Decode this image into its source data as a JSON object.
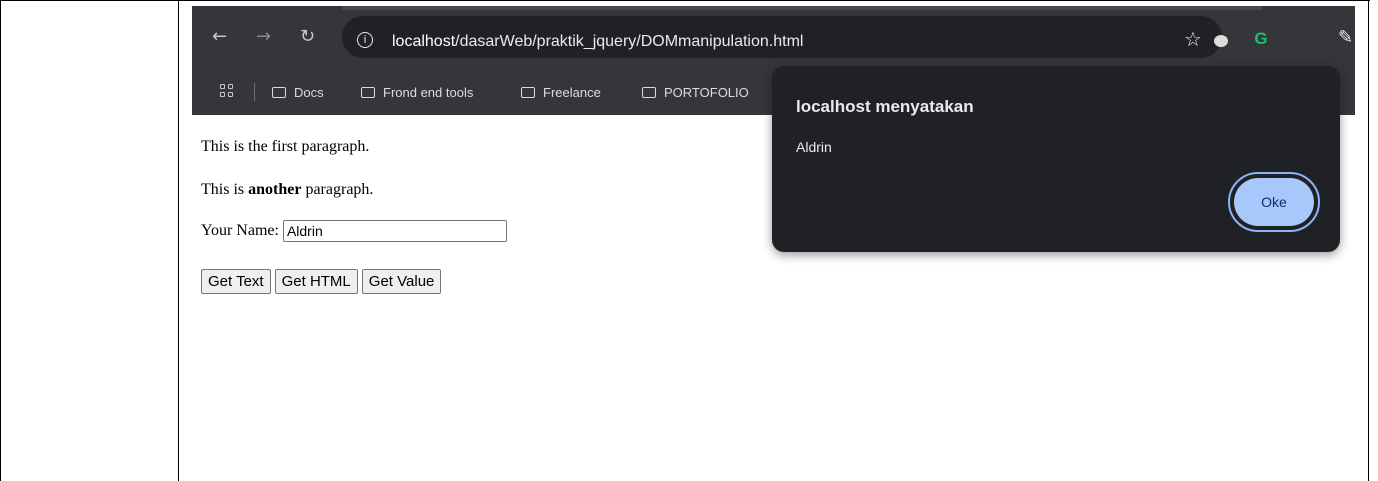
{
  "browser": {
    "url_host": "localhost",
    "url_path": "/dasarWeb/praktik_jquery/DOMmanipulation.html",
    "nav_icons": [
      "back-arrow-icon",
      "forward-arrow-icon",
      "reload-icon",
      "info-icon"
    ],
    "toolbar_icons": [
      "star-icon",
      "extension-icon",
      "grammarly-icon",
      "pen-icon"
    ],
    "bookmarks": [
      "Docs",
      "Frond end tools",
      "Freelance",
      "PORTOFOLIO"
    ],
    "colors": {
      "toolbar_bg": "#35363a",
      "omnibox_bg": "#202124"
    }
  },
  "page": {
    "paragraph1": "This is the first paragraph.",
    "paragraph2_before": "This is ",
    "paragraph2_bold": "another",
    "paragraph2_after": " paragraph.",
    "name_label": "Your Name:",
    "name_value": "Aldrin",
    "buttons": [
      "Get Text",
      "Get HTML",
      "Get Value"
    ]
  },
  "dialog": {
    "title": "localhost menyatakan",
    "message": "Aldrin",
    "ok_label": "Oke",
    "colors": {
      "bg": "#202124",
      "button_bg": "#a8c7fa",
      "button_text": "#062e6f"
    }
  }
}
